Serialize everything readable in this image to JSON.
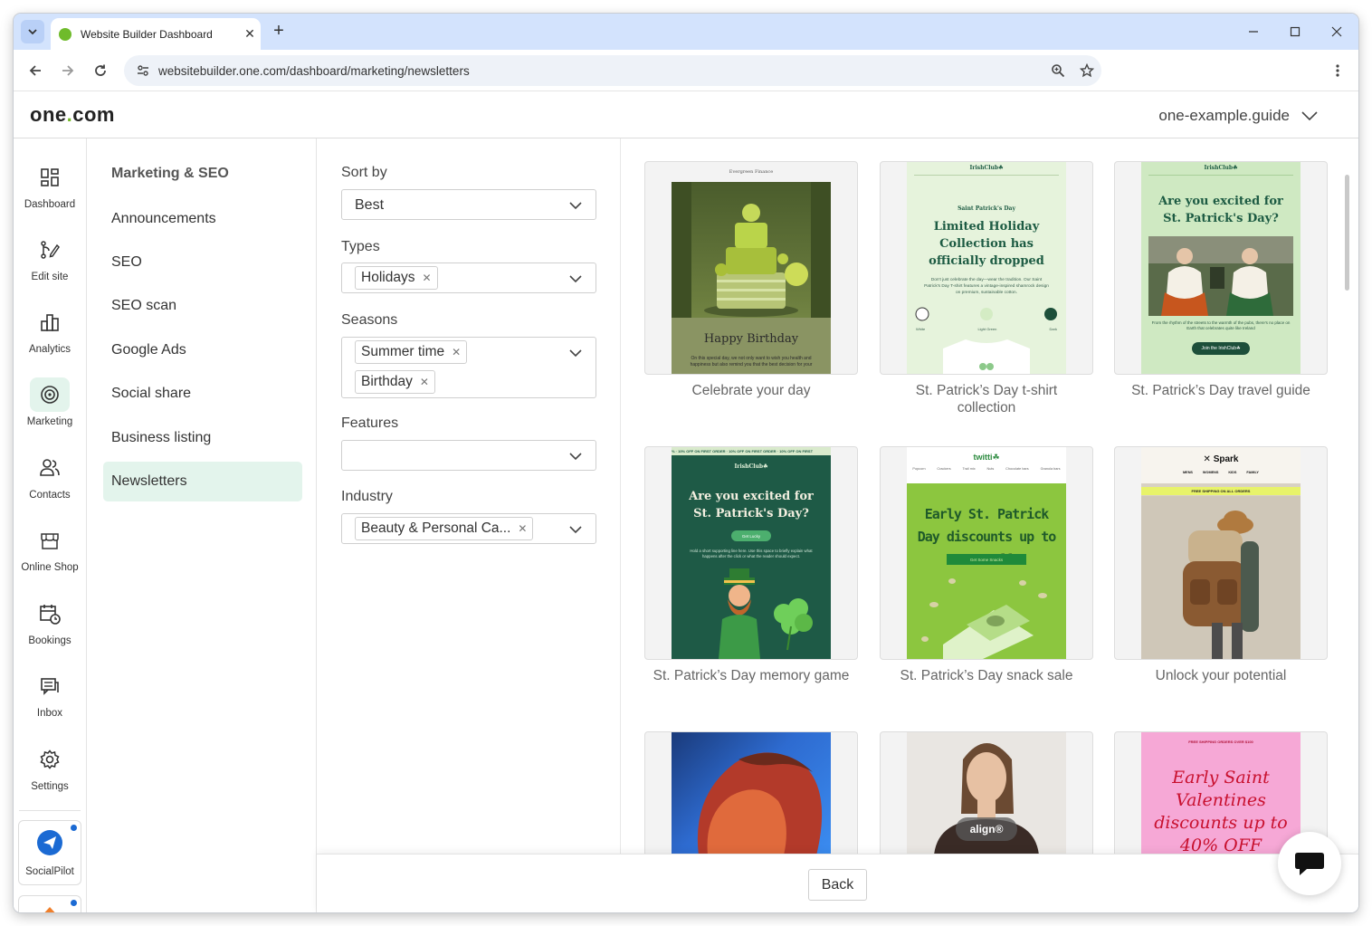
{
  "browser": {
    "tab_title": "Website Builder Dashboard",
    "url": "websitebuilder.one.com/dashboard/marketing/newsletters"
  },
  "header": {
    "logo_main": "one",
    "logo_dot": ".",
    "logo_tld": "com",
    "domain": "one-example.guide"
  },
  "rail": {
    "items": [
      {
        "label": "Dashboard",
        "icon": "grid-icon"
      },
      {
        "label": "Edit site",
        "icon": "edit-site-icon"
      },
      {
        "label": "Analytics",
        "icon": "bar-chart-icon"
      },
      {
        "label": "Marketing",
        "icon": "target-icon",
        "active": true
      },
      {
        "label": "Contacts",
        "icon": "contacts-icon"
      },
      {
        "label": "Online Shop",
        "icon": "shop-icon"
      },
      {
        "label": "Bookings",
        "icon": "calendar-clock-icon"
      },
      {
        "label": "Inbox",
        "icon": "inbox-icon"
      },
      {
        "label": "Settings",
        "icon": "gear-icon"
      }
    ],
    "apps": [
      {
        "label": "SocialPilot",
        "icon": "paper-plane-icon"
      }
    ]
  },
  "subnav": {
    "title": "Marketing & SEO",
    "items": [
      "Announcements",
      "SEO",
      "SEO scan",
      "Google Ads",
      "Social share",
      "Business listing",
      "Newsletters"
    ],
    "active": "Newsletters"
  },
  "filters": {
    "sort_label": "Sort by",
    "sort_value": "Best",
    "types_label": "Types",
    "types_chips": [
      "Holidays"
    ],
    "seasons_label": "Seasons",
    "seasons_chips": [
      "Summer time",
      "Birthday"
    ],
    "features_label": "Features",
    "industry_label": "Industry",
    "industry_chips": [
      "Beauty & Personal Ca..."
    ]
  },
  "templates": [
    {
      "title": "Celebrate your day",
      "art": {
        "brand": "Evergreen Finance",
        "heading": "Happy Birthday",
        "body": "On this special day, we not only want to wish you health and happiness but also remind you that the best decision for your"
      }
    },
    {
      "title": "St. Patrick’s Day t-shirt collection",
      "art": {
        "brand": "IrishClub☘",
        "kicker": "Saint Patrick's Day",
        "heading": "Limited Holiday Collection has officially dropped",
        "body": "Don't just celebrate the day—wear the tradition. Our Saint Patrick's Day T-shirt features a vintage-inspired shamrock design on premium, sustainable cotton.",
        "swatches": [
          "White",
          "Light Green",
          "Dark"
        ]
      }
    },
    {
      "title": "St. Patrick’s Day travel guide",
      "art": {
        "brand": "IrishClub☘",
        "heading": "Are you excited for St. Patrick's Day?",
        "body": "From the rhythm of the streets to the warmth of the pubs, there's no place on Earth that celebrates quite like Ireland",
        "cta": "Join the IrishClub☘"
      }
    },
    {
      "title": "St. Patrick’s Day memory game",
      "art": {
        "ticker": "% · 10% OFF ON FIRST ORDER · 10% OFF ON FIRST ORDER · 10% OFF ON FIRST",
        "brand": "IrishClub☘",
        "heading": "Are you excited for St. Patrick's Day?",
        "cta": "Get Lucky",
        "body": "Hold a short supporting line here. Use this space to briefly explain what happens after the click or what the reader should expect."
      }
    },
    {
      "title": "St. Patrick’s Day snack sale",
      "art": {
        "brand": "twitti☘",
        "nav": [
          "Popcorn",
          "Crackers",
          "Trail mix",
          "Nuts",
          "Chocolate bars",
          "Granola bars"
        ],
        "heading": "Early St. Patrick Day discounts up to 40% off",
        "cta": "Get Some Snacks"
      }
    },
    {
      "title": "Unlock your potential",
      "art": {
        "brand": "Spark",
        "nav": [
          "MENS",
          "WOMENS",
          "KIDS",
          "FAMILY"
        ],
        "banner": "FREE SHIPPING ON ALL ORDERS"
      }
    },
    {
      "title": "",
      "art": {}
    },
    {
      "title": "",
      "art": {
        "badge": "align®"
      }
    },
    {
      "title": "",
      "art": {
        "banner": "FREE SHIPPING ORDERS OVER $100",
        "heading": "Early Saint Valentines discounts up to 40% OFF"
      }
    }
  ],
  "bottom": {
    "back_label": "Back"
  },
  "colors": {
    "brand_green": "#76b82a",
    "active_bg": "#e3f4ec",
    "irish_green": "#1e5a46",
    "snack_green": "#8cc63f",
    "valentine_pink": "#f9a8d4"
  }
}
